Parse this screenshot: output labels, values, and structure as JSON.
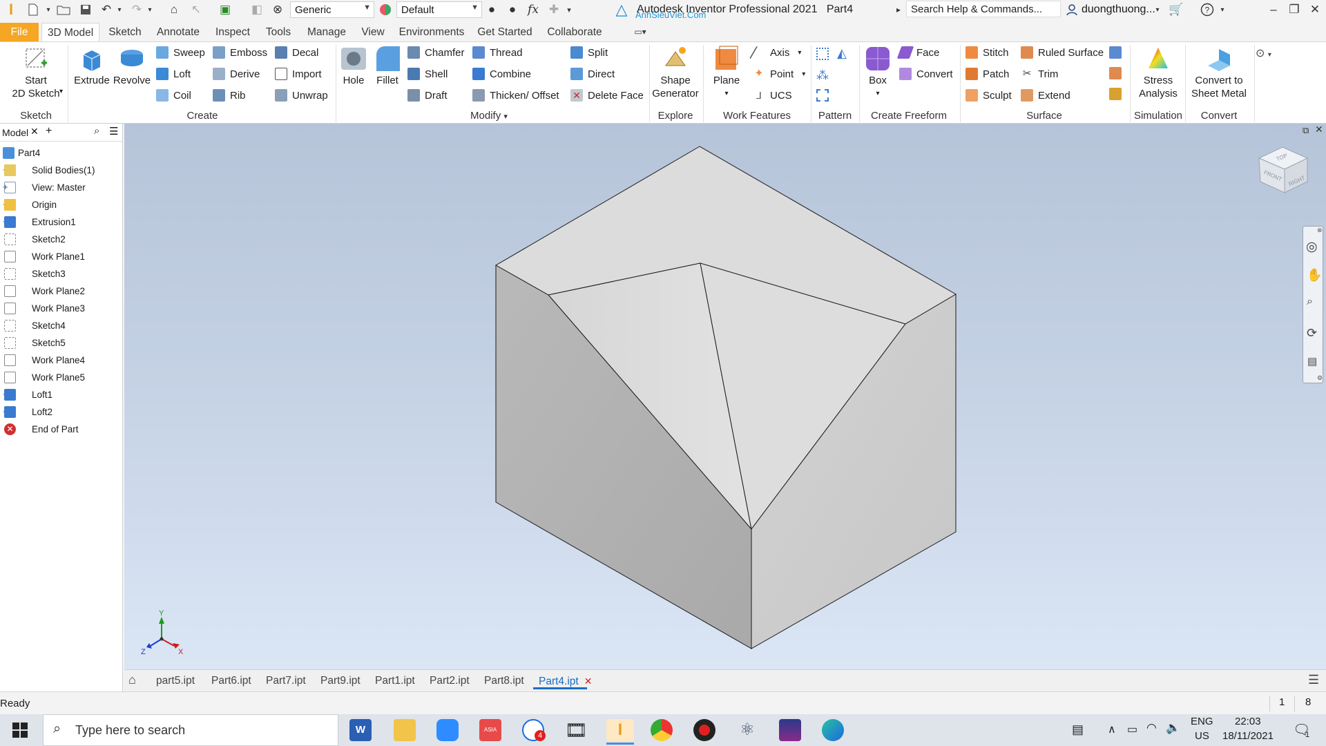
{
  "window": {
    "title": "Autodesk Inventor Professional 2021",
    "document": "Part4",
    "watermark": "AnhSieuViet.Com",
    "search_placeholder": "Search Help & Commands...",
    "user": "duongthuong...",
    "material_combo": "Generic",
    "appearance_combo": "Default"
  },
  "tabs": [
    {
      "label": "File"
    },
    {
      "label": "3D Model"
    },
    {
      "label": "Sketch"
    },
    {
      "label": "Annotate"
    },
    {
      "label": "Inspect"
    },
    {
      "label": "Tools"
    },
    {
      "label": "Manage"
    },
    {
      "label": "View"
    },
    {
      "label": "Environments"
    },
    {
      "label": "Get Started"
    },
    {
      "label": "Collaborate"
    }
  ],
  "ribbon": {
    "sketch": {
      "group": "Sketch",
      "start_line1": "Start",
      "start_line2": "2D Sketch"
    },
    "create": {
      "group": "Create",
      "extrude": "Extrude",
      "revolve": "Revolve",
      "sweep": "Sweep",
      "loft": "Loft",
      "coil": "Coil",
      "emboss": "Emboss",
      "derive": "Derive",
      "rib": "Rib",
      "decal": "Decal",
      "import": "Import",
      "unwrap": "Unwrap"
    },
    "modify": {
      "group": "Modify",
      "hole": "Hole",
      "fillet": "Fillet",
      "chamfer": "Chamfer",
      "shell": "Shell",
      "draft": "Draft",
      "thread": "Thread",
      "combine": "Combine",
      "thicken": "Thicken/ Offset",
      "split": "Split",
      "direct": "Direct",
      "delete_face": "Delete Face"
    },
    "explore": {
      "group": "Explore",
      "line1": "Shape",
      "line2": "Generator"
    },
    "work_features": {
      "group": "Work Features",
      "plane": "Plane",
      "axis": "Axis",
      "point": "Point",
      "ucs": "UCS"
    },
    "pattern": {
      "group": "Pattern"
    },
    "freeform": {
      "group": "Create Freeform",
      "box": "Box",
      "face": "Face",
      "convert": "Convert"
    },
    "surface": {
      "group": "Surface",
      "stitch": "Stitch",
      "patch": "Patch",
      "sculpt": "Sculpt",
      "ruled": "Ruled Surface",
      "trim": "Trim",
      "extend": "Extend"
    },
    "simulation": {
      "group": "Simulation",
      "line1": "Stress",
      "line2": "Analysis"
    },
    "convert": {
      "group": "Convert",
      "line1": "Convert to",
      "line2": "Sheet Metal"
    }
  },
  "browser": {
    "tab": "Model",
    "items": [
      {
        "label": "Part4"
      },
      {
        "label": "Solid Bodies(1)"
      },
      {
        "label": "View: Master"
      },
      {
        "label": "Origin"
      },
      {
        "label": "Extrusion1"
      },
      {
        "label": "Sketch2"
      },
      {
        "label": "Work Plane1"
      },
      {
        "label": "Sketch3"
      },
      {
        "label": "Work Plane2"
      },
      {
        "label": "Work Plane3"
      },
      {
        "label": "Sketch4"
      },
      {
        "label": "Sketch5"
      },
      {
        "label": "Work Plane4"
      },
      {
        "label": "Work Plane5"
      },
      {
        "label": "Loft1"
      },
      {
        "label": "Loft2"
      },
      {
        "label": "End of Part"
      }
    ]
  },
  "viewcube": {
    "top": "TOP",
    "front": "FRONT",
    "right": "RIGHT"
  },
  "triad": {
    "x": "X",
    "y": "Y",
    "z": "Z"
  },
  "doc_tabs": [
    {
      "label": "part5.ipt"
    },
    {
      "label": "Part6.ipt"
    },
    {
      "label": "Part7.ipt"
    },
    {
      "label": "Part9.ipt"
    },
    {
      "label": "Part1.ipt"
    },
    {
      "label": "Part2.ipt"
    },
    {
      "label": "Part8.ipt"
    },
    {
      "label": "Part4.ipt"
    }
  ],
  "status": {
    "text": "Ready",
    "count1": "1",
    "count2": "8"
  },
  "taskbar": {
    "search_placeholder": "Type here to search",
    "lang1": "ENG",
    "lang2": "US",
    "time": "22:03",
    "date": "18/11/2021",
    "notif_count": "1",
    "zalo_badge": "4"
  }
}
